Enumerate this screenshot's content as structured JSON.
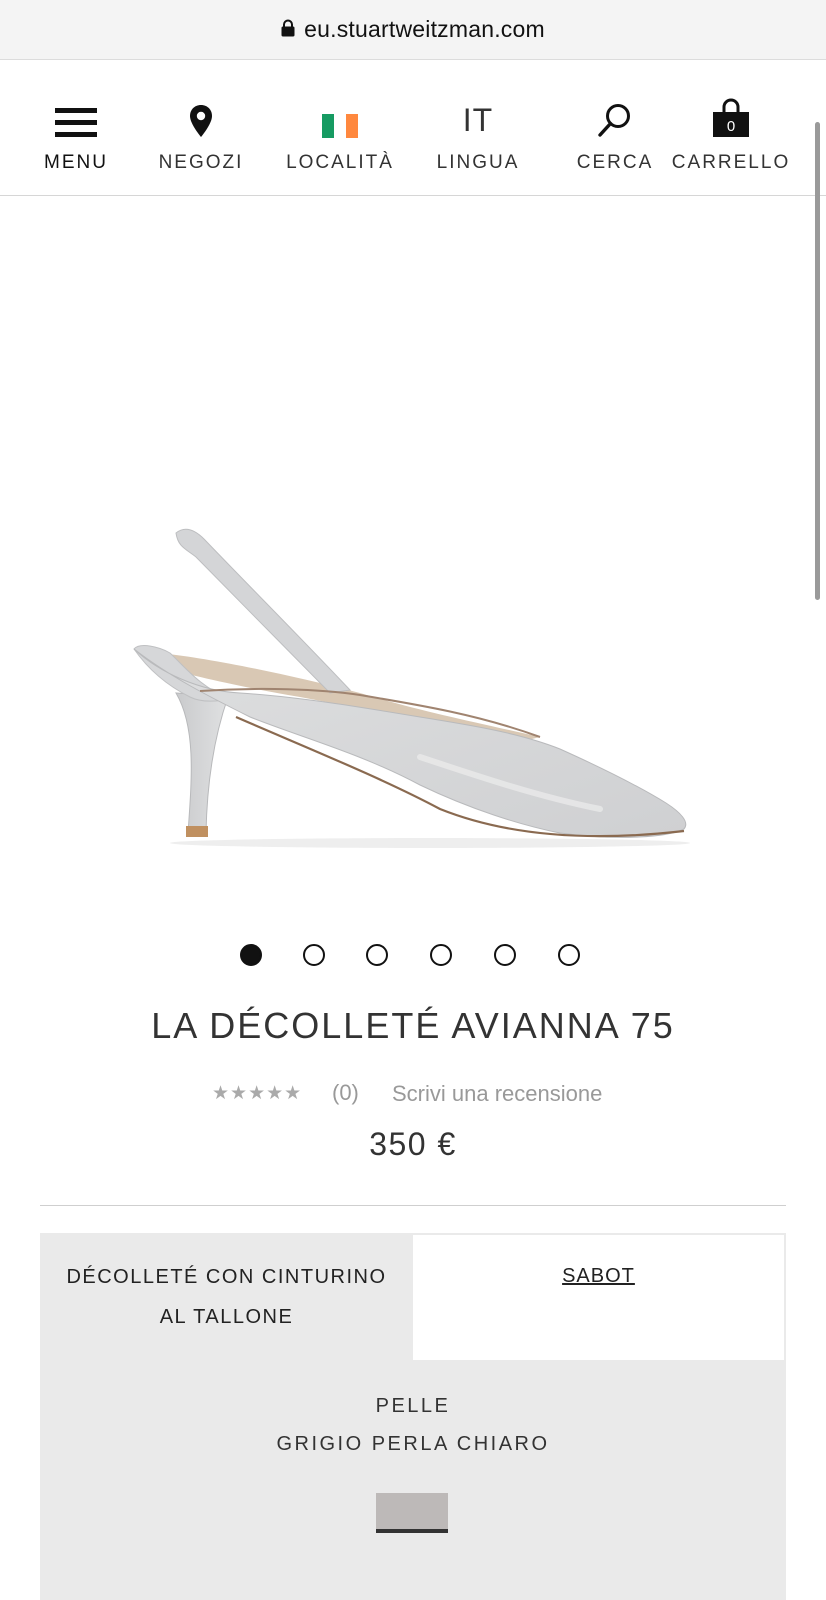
{
  "browser": {
    "url": "eu.stuartweitzman.com",
    "lock_icon": "lock-icon"
  },
  "nav": {
    "items": [
      {
        "label": "MENU",
        "icon": "hamburger-icon"
      },
      {
        "label": "NEGOZI",
        "icon": "map-pin-icon"
      },
      {
        "label": "LOCALITÀ",
        "icon": "ireland-flag-icon"
      },
      {
        "label": "LINGUA",
        "icon_text": "IT"
      },
      {
        "label": "CERCA",
        "icon": "search-icon"
      },
      {
        "label": "CARRELLO",
        "icon": "shopping-bag-icon",
        "count": "0"
      }
    ],
    "flag_colors": [
      "#169b62",
      "#ffffff",
      "#ff883e"
    ]
  },
  "product": {
    "image": "slingback-pump-image",
    "gallery": {
      "total": 6,
      "active_index": 0
    },
    "title": "LA DÉCOLLETÉ AVIANNA 75",
    "rating": {
      "stars": "★★★★★",
      "count": "(0)",
      "write_review": "Scrivi una recensione"
    },
    "price": "350 €"
  },
  "variants": {
    "styles": [
      {
        "label": "DÉCOLLETÉ CON CINTURINO AL TALLONE",
        "selected": true
      },
      {
        "label": "SABOT",
        "selected": false
      }
    ],
    "material": "PELLE",
    "color": "GRIGIO PERLA CHIARO",
    "swatch_color": "#bdb9b8"
  }
}
